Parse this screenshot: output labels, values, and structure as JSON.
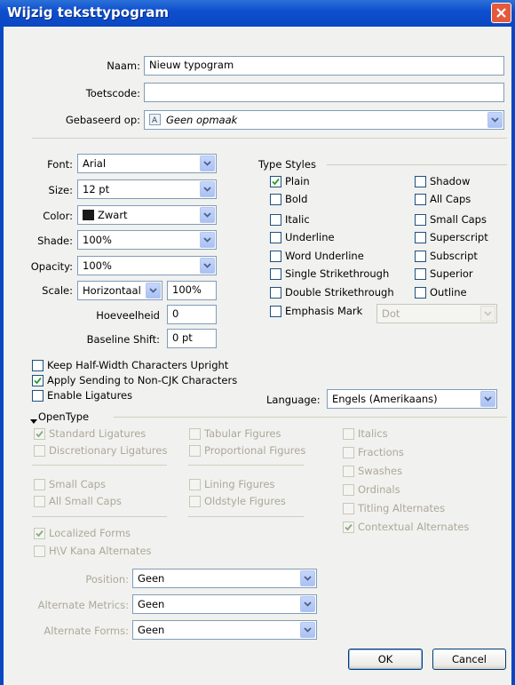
{
  "window": {
    "title": "Wijzig teksttypogram"
  },
  "general": {
    "name_label": "Naam:",
    "name_value": "Nieuw typogram",
    "shortcut_label": "Toetscode:",
    "shortcut_value": "",
    "based_on_label": "Gebaseerd op:",
    "based_on_value": "Geen opmaak"
  },
  "char": {
    "font_label": "Font:",
    "font_value": "Arial",
    "size_label": "Size:",
    "size_value": "12 pt",
    "color_label": "Color:",
    "color_value": "Zwart",
    "color_swatch": "#1a1a1a",
    "shade_label": "Shade:",
    "shade_value": "100%",
    "opacity_label": "Opacity:",
    "opacity_value": "100%",
    "scale_label": "Scale:",
    "scale_mode": "Horizontaal",
    "scale_value": "100%",
    "amount_label": "Hoeveelheid",
    "amount_value": "0",
    "baseline_label": "Baseline Shift:",
    "baseline_value": "0 pt"
  },
  "type_styles": {
    "heading": "Type Styles",
    "left": [
      {
        "label": "Plain",
        "checked": true
      },
      {
        "label": "Bold",
        "checked": false
      },
      {
        "label": "Italic",
        "checked": false
      },
      {
        "label": "Underline",
        "checked": false
      },
      {
        "label": "Word Underline",
        "checked": false
      },
      {
        "label": "Single Strikethrough",
        "checked": false
      },
      {
        "label": "Double Strikethrough",
        "checked": false
      },
      {
        "label": "Emphasis Mark",
        "checked": false
      }
    ],
    "right": [
      {
        "label": "Shadow",
        "checked": false
      },
      {
        "label": "All Caps",
        "checked": false
      },
      {
        "label": "Small Caps",
        "checked": false
      },
      {
        "label": "Superscript",
        "checked": false
      },
      {
        "label": "Subscript",
        "checked": false
      },
      {
        "label": "Superior",
        "checked": false
      },
      {
        "label": "Outline",
        "checked": false
      }
    ],
    "emphasis_value": "Dot"
  },
  "cjk": {
    "keep_upright": {
      "label": "Keep Half-Width Characters Upright",
      "checked": false
    },
    "apply_sending": {
      "label": "Apply Sending to Non-CJK Characters",
      "checked": true
    },
    "enable_ligatures": {
      "label": "Enable Ligatures",
      "checked": false
    }
  },
  "language": {
    "label": "Language:",
    "value": "Engels (Amerikaans)"
  },
  "opentype": {
    "heading": "OpenType",
    "col1": [
      {
        "label": "Standard Ligatures",
        "checked": true
      },
      {
        "label": "Discretionary Ligatures",
        "checked": false
      },
      {
        "label": "Small Caps",
        "checked": false
      },
      {
        "label": "All Small Caps",
        "checked": false
      },
      {
        "label": "Localized Forms",
        "checked": true
      },
      {
        "label": "H\\V Kana Alternates",
        "checked": false
      }
    ],
    "col2": [
      {
        "label": "Tabular Figures",
        "checked": false
      },
      {
        "label": "Proportional Figures",
        "checked": false
      },
      {
        "label": "Lining Figures",
        "checked": false
      },
      {
        "label": "Oldstyle Figures",
        "checked": false
      }
    ],
    "col3": [
      {
        "label": "Italics",
        "checked": false
      },
      {
        "label": "Fractions",
        "checked": false
      },
      {
        "label": "Swashes",
        "checked": false
      },
      {
        "label": "Ordinals",
        "checked": false
      },
      {
        "label": "Titling Alternates",
        "checked": false
      },
      {
        "label": "Contextual Alternates",
        "checked": true
      }
    ],
    "position_label": "Position:",
    "position_value": "Geen",
    "alt_metrics_label": "Alternate Metrics:",
    "alt_metrics_value": "Geen",
    "alt_forms_label": "Alternate Forms:",
    "alt_forms_value": "Geen"
  },
  "buttons": {
    "ok": "OK",
    "cancel": "Cancel"
  }
}
